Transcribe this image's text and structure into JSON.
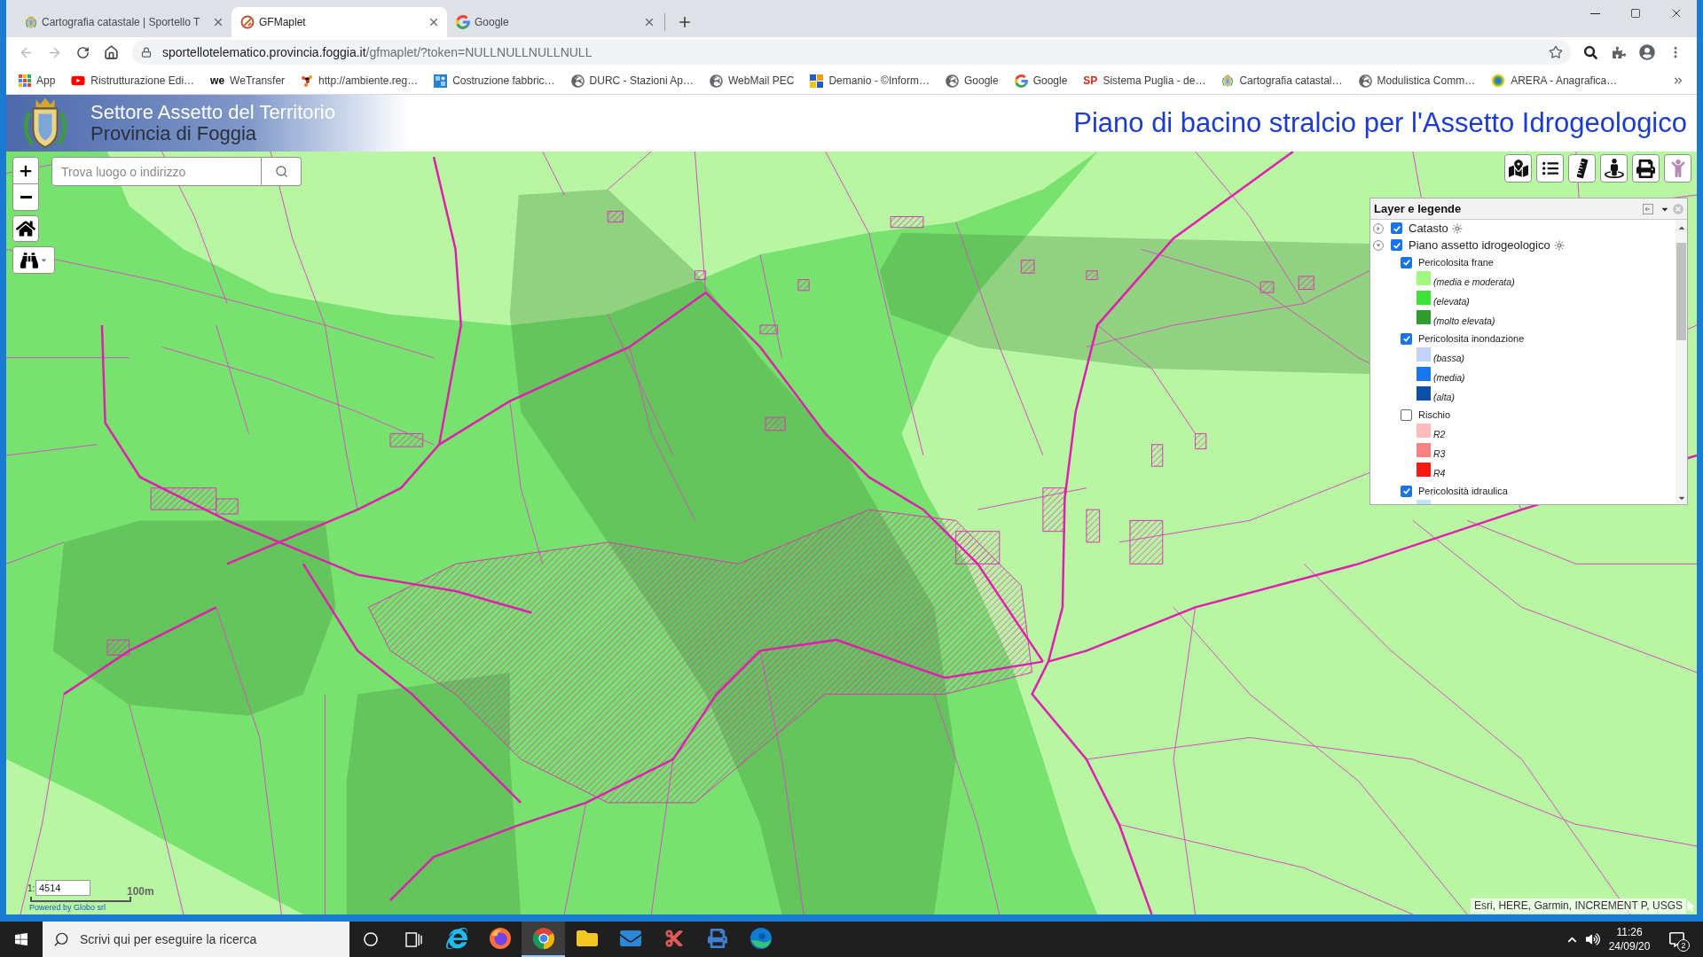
{
  "browser": {
    "tabs": [
      {
        "title": "Cartografia catastale | Sportello T",
        "selected": false
      },
      {
        "title": "GFMaplet",
        "selected": true
      },
      {
        "title": "Google",
        "selected": false
      }
    ],
    "address": {
      "host": "sportellotelematico.provincia.foggia.it",
      "path": "/gfmaplet/?token=NULLNULLNULLNULL"
    },
    "bookmarks": [
      {
        "label": "App"
      },
      {
        "label": "Ristrutturazione Edi…"
      },
      {
        "label": "WeTransfer",
        "logo": "we",
        "color": "#111111"
      },
      {
        "label": "http://ambiente.reg…"
      },
      {
        "label": "Costruzione fabbric…"
      },
      {
        "label": "DURC - Stazioni Ap…"
      },
      {
        "label": "WebMail PEC"
      },
      {
        "label": "Demanio - ©Inform…"
      },
      {
        "label": "Google"
      },
      {
        "label": "Google"
      },
      {
        "label": "Sistema Puglia - de…",
        "logo": "SP",
        "color": "#d52b1e"
      },
      {
        "label": "Cartografia catastal…"
      },
      {
        "label": "Modulistica Comm…"
      },
      {
        "label": "ARERA - Anagrafica…"
      }
    ]
  },
  "header": {
    "agency": "Settore Assetto del Territorio",
    "province": "Provincia di Foggia",
    "title": "Piano di bacino stralcio per l'Assetto Idrogeologico"
  },
  "map": {
    "search": {
      "placeholder": "Trova luogo o indirizzo"
    },
    "scale": {
      "prefix": "1:",
      "value": "4514",
      "distance": "100m"
    },
    "credit": "Powered by Globo srl",
    "attribution": "Esri, HERE, Garmin, INCREMENT P, USGS"
  },
  "layer_panel": {
    "title": "Layer e legende",
    "layers": [
      {
        "kind": "layer",
        "label": "Catasto",
        "checked": true,
        "expanded": false
      },
      {
        "kind": "layer",
        "label": "Piano assetto idrogeologico",
        "checked": true,
        "expanded": true,
        "children": [
          {
            "kind": "layer",
            "label": "Pericolosita frane",
            "checked": true,
            "children": [
              {
                "kind": "legend",
                "label": "(media e moderata)",
                "color": "#a3f882"
              },
              {
                "kind": "legend",
                "label": "(elevata)",
                "color": "#3de33a"
              },
              {
                "kind": "legend",
                "label": "(molto elevata)",
                "color": "#2f9c2c"
              }
            ]
          },
          {
            "kind": "layer",
            "label": "Pericolosita inondazione",
            "checked": true,
            "children": [
              {
                "kind": "legend",
                "label": "(bassa)",
                "color": "#c2d3f7"
              },
              {
                "kind": "legend",
                "label": "(media)",
                "color": "#1776f0"
              },
              {
                "kind": "legend",
                "label": "(alta)",
                "color": "#0c4fa8"
              }
            ]
          },
          {
            "kind": "layer",
            "label": "Rischio",
            "checked": false,
            "children": [
              {
                "kind": "legend",
                "label": "R2",
                "color": "#fdbcbc"
              },
              {
                "kind": "legend",
                "label": "R3",
                "color": "#f88282"
              },
              {
                "kind": "legend",
                "label": "R4",
                "color": "#f81a10"
              }
            ]
          },
          {
            "kind": "layer",
            "label": "Pericolosità idraulica",
            "checked": true,
            "children": [
              {
                "kind": "legend",
                "color": "#bfe4f8"
              }
            ]
          }
        ]
      }
    ]
  },
  "taskbar": {
    "search": {
      "placeholder": "Scrivi qui per eseguire la ricerca"
    },
    "apps": [
      {
        "kind": "ie",
        "selected": false
      },
      {
        "kind": "firefox",
        "selected": false
      },
      {
        "kind": "chrome",
        "selected": true
      },
      {
        "kind": "explorer",
        "selected": false
      },
      {
        "kind": "mail",
        "selected": false
      },
      {
        "kind": "snip",
        "selected": false
      },
      {
        "kind": "printer",
        "selected": false
      },
      {
        "kind": "edge",
        "selected": false
      }
    ],
    "time": "11:26",
    "date": "24/09/20",
    "notifications": "2"
  }
}
